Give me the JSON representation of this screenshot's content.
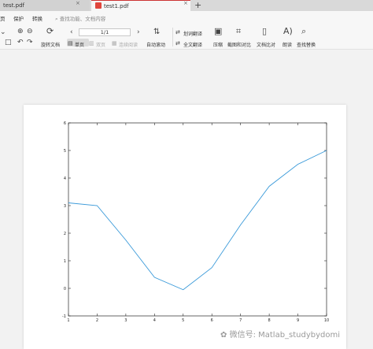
{
  "tabs": [
    {
      "label": "test.pdf",
      "close": "×"
    },
    {
      "label": "test1.pdf",
      "close": "×"
    }
  ],
  "add_tab": "+",
  "menu": {
    "item1": "页",
    "item2": "保护",
    "item3": "转换"
  },
  "search_placeholder": "查找功能、文档内容",
  "toolbar": {
    "rotate": "旋转文档",
    "page": "1/1",
    "single": "单页",
    "double": "双页",
    "continuous": "连续阅读",
    "autoscroll": "自动滚动",
    "translate_word": "划词翻译",
    "translate_full": "全文翻译",
    "compress": "压缩",
    "screenshot": "截图和对比",
    "compare": "文档比对",
    "read": "朗读",
    "find_replace": "查找替换"
  },
  "watermark": "微信号: Matlab_studybydomi",
  "chart_data": {
    "type": "line",
    "x": [
      1,
      2,
      3,
      4,
      5,
      6,
      7,
      8,
      9,
      10
    ],
    "values": [
      3.1,
      3.0,
      1.75,
      0.4,
      -0.05,
      0.75,
      2.3,
      3.7,
      4.5,
      5.0
    ],
    "xlim": [
      1,
      10
    ],
    "ylim": [
      -1,
      6
    ],
    "xticks": [
      "1",
      "2",
      "3",
      "4",
      "5",
      "6",
      "7",
      "8",
      "9",
      "10"
    ],
    "yticks": [
      "-1",
      "0",
      "1",
      "2",
      "3",
      "4",
      "5",
      "6"
    ],
    "grid": false,
    "line_color": "#3a9ad9"
  }
}
